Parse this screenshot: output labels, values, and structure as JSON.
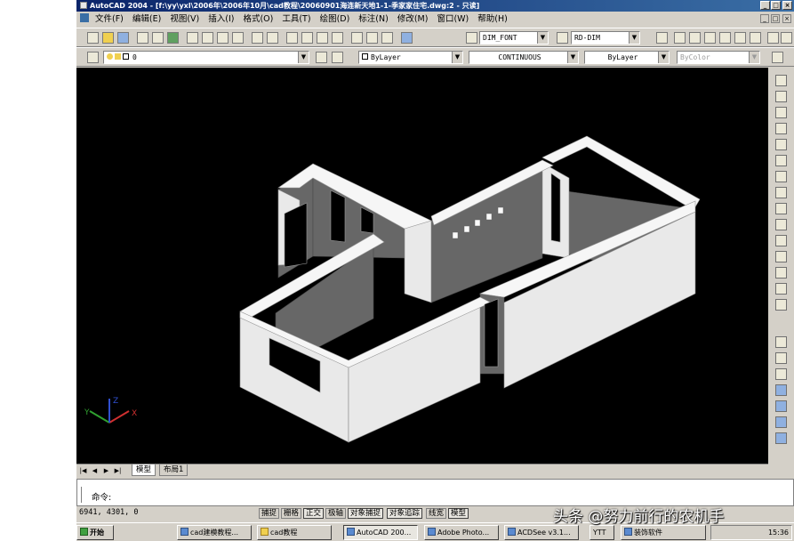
{
  "window": {
    "title": "AutoCAD 2004 - [f:\\yy\\yxl\\2006年\\2006年10月\\cad教程\\20060901海连新天地1-1-季家家住宅.dwg:2 - 只读]",
    "minimize": "_",
    "restore": "□",
    "close": "×"
  },
  "menu": {
    "items": [
      "文件(F)",
      "编辑(E)",
      "视图(V)",
      "插入(I)",
      "格式(O)",
      "工具(T)",
      "绘图(D)",
      "标注(N)",
      "修改(M)",
      "窗口(W)",
      "帮助(H)"
    ]
  },
  "toolbar": {
    "textstyle": "DIM_FONT",
    "dimstyle": "RD-DIM",
    "layer": "0",
    "color": "ByLayer",
    "linetype": "CONTINUOUS",
    "lineweight": "ByLayer",
    "plotstyle": "ByColor"
  },
  "tabs": [
    "模型",
    "布局1"
  ],
  "command": {
    "prompt": "命令:"
  },
  "status": {
    "coords": "6941, 4301, 0",
    "toggles": [
      "捕捉",
      "栅格",
      "正交",
      "极轴",
      "对象捕捉",
      "对象追踪",
      "线宽",
      "模型"
    ],
    "active": [
      "正交",
      "对象捕捉",
      "对象追踪",
      "模型"
    ]
  },
  "taskbar": {
    "start": "开始",
    "items": [
      "cad建模教程...",
      "cad教程",
      "AutoCAD 200...",
      "Adobe Photo...",
      "ACDSee v3.1...",
      "YTT",
      "装饰软件"
    ],
    "active_item": "AutoCAD 200...",
    "clock": "15:36"
  },
  "watermark": "头条 @努力前行的农机手",
  "axis": {
    "x": "X",
    "y": "Y",
    "z": "Z"
  },
  "colors": {
    "titlebar": "#0a246a",
    "viewport": "#000000",
    "wall_top": "#f2f2f2",
    "wall_side": "#676767"
  }
}
